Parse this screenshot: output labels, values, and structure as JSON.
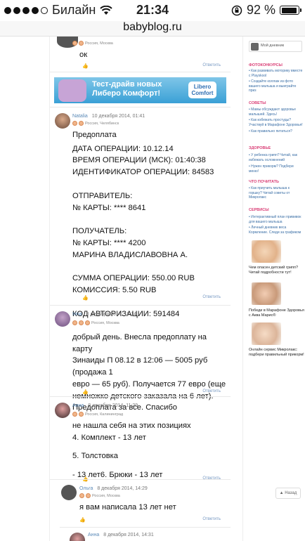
{
  "status_bar": {
    "carrier": "Билайн",
    "time": "21:34",
    "battery_percent": "92 %",
    "battery_level": 0.92
  },
  "browser": {
    "url": "babyblog.ru"
  },
  "comments": [
    {
      "author": "",
      "date": "",
      "location": "Россия, Москва",
      "text": "ок",
      "reply": "Ответить"
    },
    {
      "author": "Natalia",
      "date": "10 декабря 2014, 01:41",
      "location": "Россия, Челябинск",
      "lines": [
        "Предоплата",
        "ДАТА ОПЕРАЦИИ: 10.12.14",
        "ВРЕМЯ ОПЕРАЦИИ (МСК): 01:40:38",
        "ИДЕНТИФИКАТОР ОПЕРАЦИИ: 84583",
        "ОТПРАВИТЕЛЬ:",
        "№ КАРТЫ: **** 8641",
        "ПОЛУЧАТЕЛЬ:",
        "№ КАРТЫ: **** 4200",
        "МАРИНА ВЛАДИСЛАВОВНА А.",
        "СУММА ОПЕРАЦИИ: 550.00 RUB",
        "КОМИССИЯ: 5.50 RUB",
        "КОД АВТОРИЗАЦИИ: 591484"
      ],
      "reply": "Ответить"
    },
    {
      "author": "Irina",
      "date": "8 декабря 2014, 12:14",
      "location": "Россия, Москва",
      "lines": [
        "добрый день. Внесла предоплату на карту",
        "Зинаиды П 08.12 в 12:06 — 5005 руб (продажа 1",
        "евро — 65 руб). Получается 77 евро (еще",
        "немножко детского заказала на 6 лет).",
        "Предоплата за все. Спасибо"
      ],
      "reply": "Ответить"
    },
    {
      "author": "Анна",
      "date": "8 декабря 2014, 11:29",
      "location": "Россия, Калининград",
      "lines": [
        "не нашла себя на этих позициях",
        "4. Комплект - 13 лет",
        "5. Толстовка",
        "- 13 лет6. Брюки - 13 лет"
      ],
      "reply": "Ответить"
    },
    {
      "author": "Ольга",
      "date": "8 декабря 2014, 14:29",
      "location": "Россия, Москва",
      "text": "я вам написала 13 лет нет",
      "reply": "Ответить"
    },
    {
      "author": "Анна",
      "date": "8 декабря 2014, 14:31",
      "location": "",
      "text": "",
      "reply": ""
    }
  ],
  "banner": {
    "text_line1": "Тест-драйв новых",
    "text_line2": "Либеро Комфорт!",
    "logo": "Libero Comfort"
  },
  "sidebar": {
    "profile_label": "Мой дневник",
    "sections": [
      {
        "title": "ФОТОКОНКУРСЫ",
        "items": [
          "• Как развивать моторику вместе с Playskool",
          "• Создайте коллаж из фото вашего малыша и выиграйте приз"
        ]
      },
      {
        "title": "СОВЕТЫ",
        "items": [
          "• Мамы обсуждают здоровье малышей. Здесь!",
          "• Как избежать простуды? Участвуй в Марафоне Здоровья!",
          "• Как правильно питаться?"
        ]
      },
      {
        "title": "ЗДОРОВЬЕ",
        "items": [
          "• У ребенка грипп? Читай, как избежать осложнений",
          "• Нужен прикорм? Подбери меню!"
        ]
      },
      {
        "title": "ЧТО ПОЧИТАТЬ",
        "items": [
          "• Как приучить малыша к горшку? Читай советы от Микролакс"
        ]
      },
      {
        "title": "СЕРВИСЫ",
        "items": [
          "• Интерактивный план прививок для вашего малыша",
          "• Личный дневник веса Кормление. Следи за графиком"
        ]
      }
    ],
    "promos": [
      "Чем опасен детский грипп? Читай подробности тут!",
      "Победи в Марафоне Здоровья с Аква Марис®",
      "Онлайн сервис Микролакс: подбери правильный прикорм!"
    ]
  },
  "back_button": "▲ Назад"
}
